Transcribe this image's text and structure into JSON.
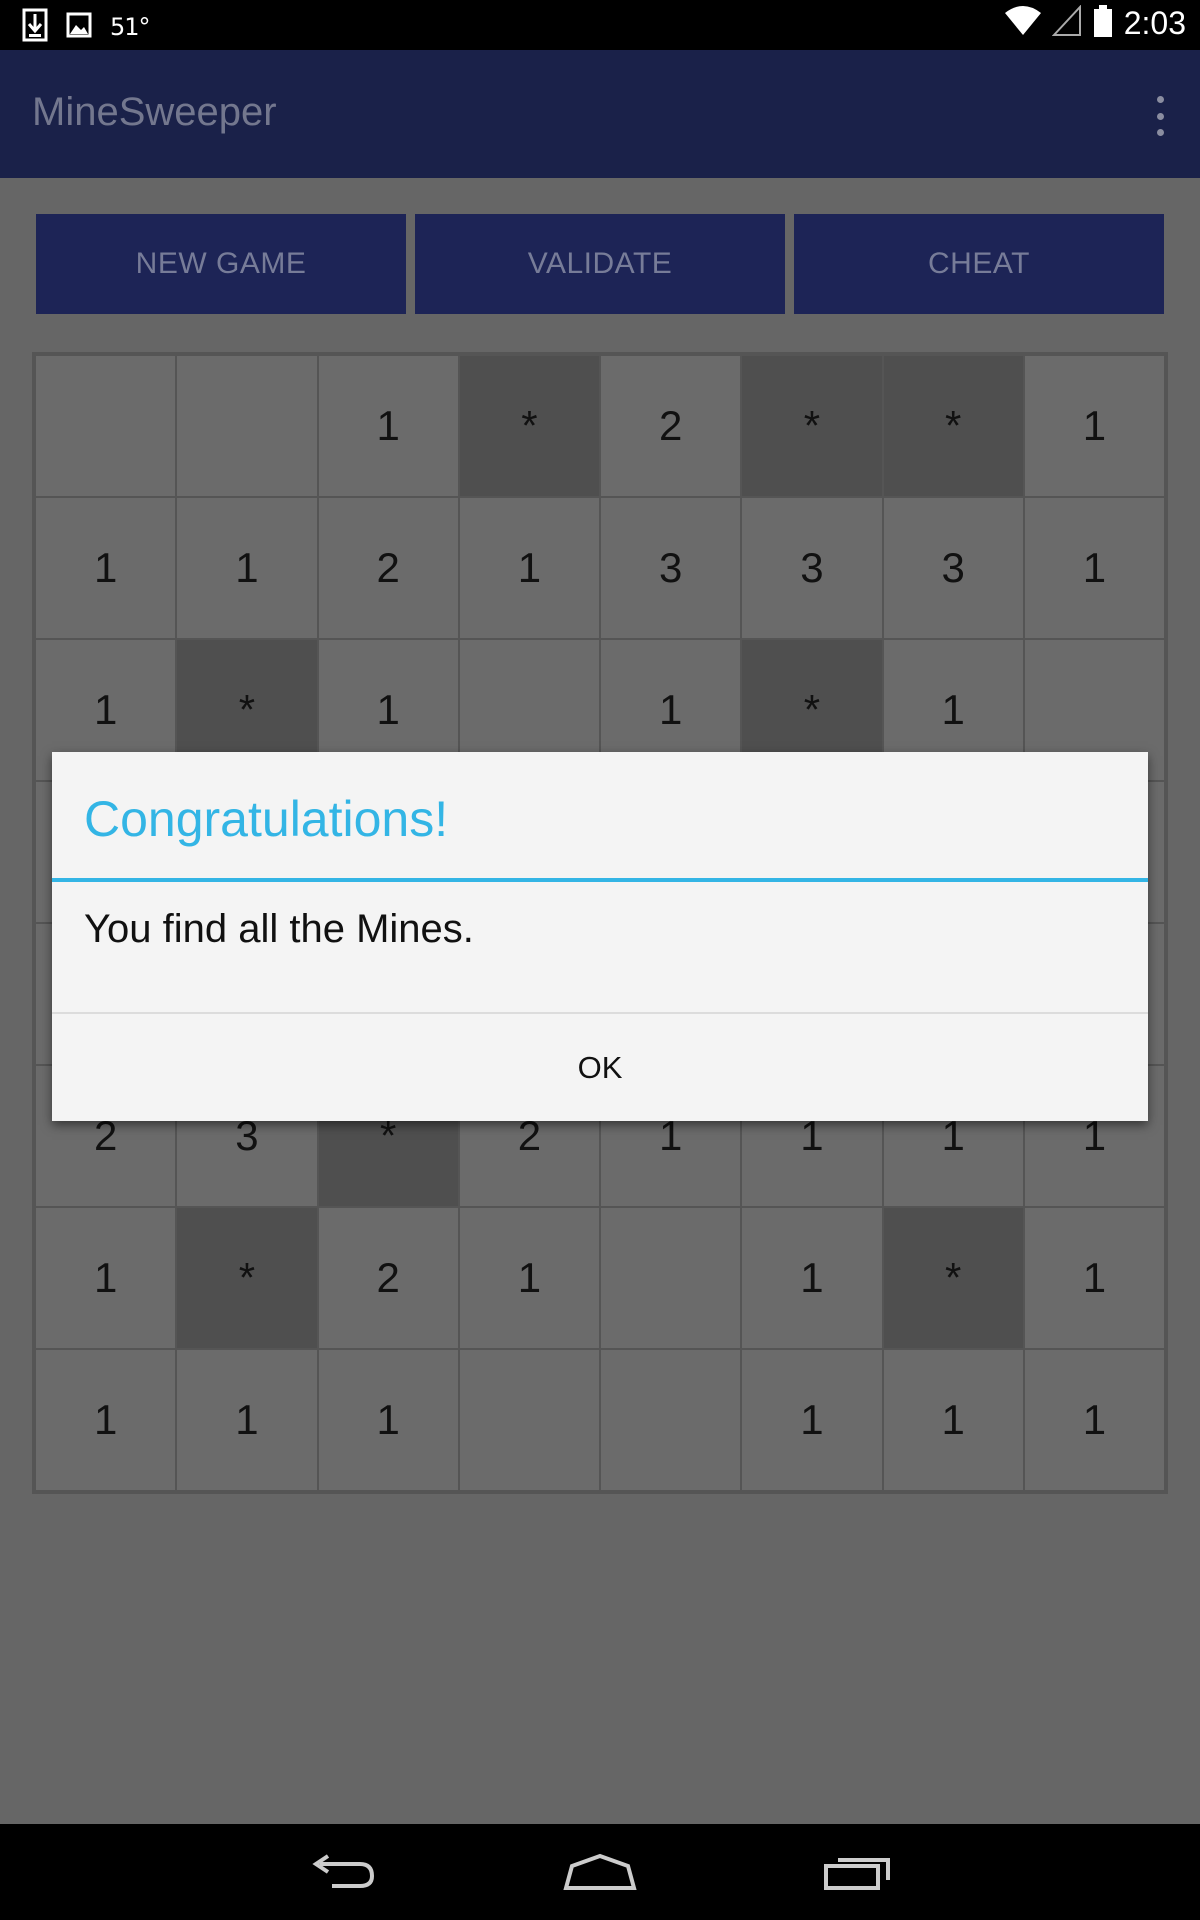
{
  "status_bar": {
    "icons": [
      "download-icon",
      "image-icon",
      "wifi-icon",
      "signal-icon",
      "battery-icon"
    ],
    "temperature": "51°",
    "time": "2:03"
  },
  "app": {
    "title": "MineSweeper",
    "menu_icon": "overflow-menu-icon",
    "buttons": {
      "new_game": "NEW GAME",
      "validate": "VALIDATE",
      "cheat": "CHEAT"
    },
    "board": {
      "rows": 8,
      "cols": 8,
      "cells": [
        [
          "",
          "",
          "1",
          "*",
          "2",
          "*",
          "*",
          "1"
        ],
        [
          "1",
          "1",
          "2",
          "1",
          "3",
          "3",
          "3",
          "1"
        ],
        [
          "1",
          "*",
          "1",
          "",
          "1",
          "*",
          "1",
          ""
        ],
        [
          "",
          "",
          "",
          "",
          "",
          "",
          "",
          ""
        ],
        [
          "",
          "",
          "",
          "",
          "",
          "",
          "",
          ""
        ],
        [
          "2",
          "3",
          "*",
          "2",
          "1",
          "1",
          "1",
          "1"
        ],
        [
          "1",
          "*",
          "2",
          "1",
          "",
          "1",
          "*",
          "1"
        ],
        [
          "1",
          "1",
          "1",
          "",
          "",
          "1",
          "1",
          "1"
        ]
      ]
    }
  },
  "dialog": {
    "title": "Congratulations!",
    "message": "You find all the Mines.",
    "ok_label": "OK"
  },
  "colors": {
    "appbar": "#1a2149",
    "button": "#1d2456",
    "dialog_accent": "#33b5e5",
    "cell": "#6b6b6b",
    "mine_cell": "#4f4f4f"
  },
  "nav_bar": {
    "icons": [
      "back-icon",
      "home-icon",
      "recent-apps-icon"
    ]
  }
}
